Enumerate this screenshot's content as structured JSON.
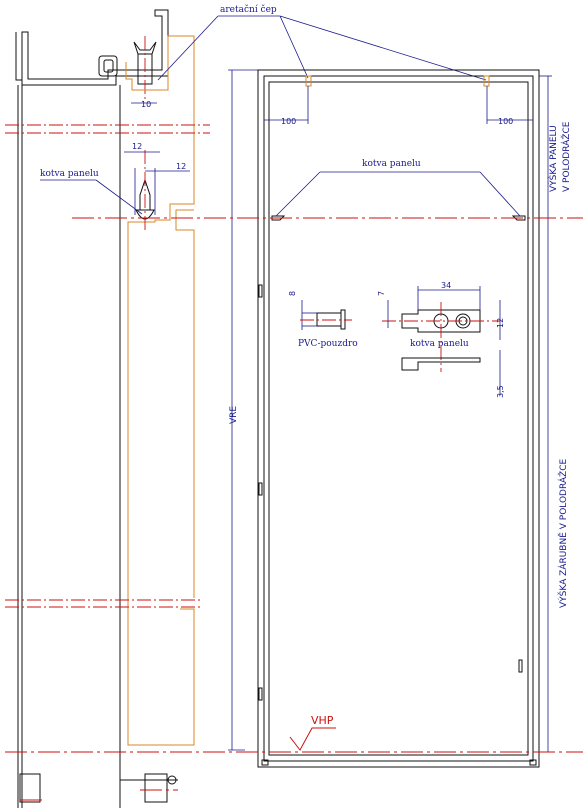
{
  "labels": {
    "aretacni_cep": "aretační čep",
    "kotva_panelu_left": "kotva panelu",
    "kotva_panelu_top": "kotva panelu",
    "kotva_panelu_detail": "kotva panelu",
    "pvc_pouzdro": "PVC-pouzdro",
    "vre": "VRE",
    "vhp": "VHP",
    "vyska_panelu_line1": "VÝŠKA PANELU",
    "vyska_panelu_line2": "V POLODRÁŽCE",
    "vyska_zarubne": "VÝŠKA ZÁRUBNĚ V POLODRÁŽCE"
  },
  "dimensions": {
    "d10": "10",
    "d12a": "12",
    "d12b": "12",
    "d100_left": "100",
    "d100_right": "100",
    "d8": "8",
    "d7": "7",
    "d34": "34",
    "d12c": "12",
    "d3_5": "3,5"
  },
  "colors": {
    "outline": "#111111",
    "section": "#d98a2a",
    "dimension": "#1a1a8c",
    "centerline": "#cc1111"
  }
}
